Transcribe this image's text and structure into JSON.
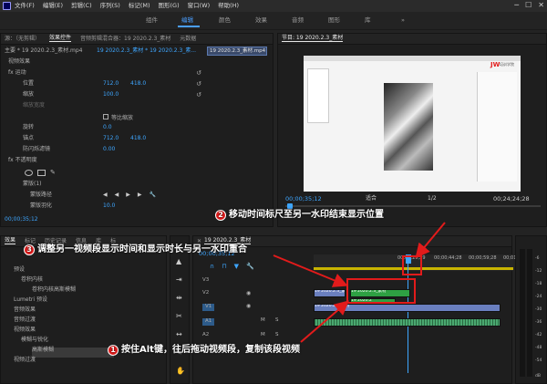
{
  "menu": {
    "items": [
      "文件(F)",
      "编辑(E)",
      "剪辑(C)",
      "序列(S)",
      "标记(M)",
      "图形(G)",
      "窗口(W)",
      "帮助(H)"
    ],
    "min": "─",
    "max": "☐",
    "close": "✕"
  },
  "workspaces": {
    "items": [
      "组件",
      "编辑",
      "颜色",
      "效果",
      "音频",
      "图形",
      "库"
    ],
    "more": "»"
  },
  "source_tabs": [
    "源：（无剪辑）",
    "效果控件",
    "音频剪辑混合器：19 2020.2.3_素材",
    "元数据"
  ],
  "effect_controls": {
    "master": "主要 * 19 2020.2.3_素材.mp4",
    "seq": "19 2020.2.3_素材 * 19 2020.2.3_素...",
    "clip_label": "19 2020.2.3_素材.mp4",
    "video_effects": "视频效果",
    "motion": "运动",
    "position": "位置",
    "pos_x": "712.0",
    "pos_y": "418.0",
    "scale": "缩放",
    "scale_v": "100.0",
    "scale_w": "缩放宽度",
    "uniform": "等比缩放",
    "rotation": "旋转",
    "rot_v": "0.0",
    "anchor": "锚点",
    "anc_x": "712.0",
    "anc_y": "418.0",
    "flicker": "防闪烁滤镜",
    "flick_v": "0.00",
    "opacity": "不透明度",
    "mask": "蒙版(1)",
    "mask_path": "蒙版路径",
    "mask_feather": "蒙版羽化",
    "feather_v": "10.0",
    "timecode": "00;00;35;12"
  },
  "program": {
    "title": "节目: 19 2020.2.3_素材",
    "timecode": "00;00;35;12",
    "fit": "适合",
    "res": "1/2",
    "duration": "00;24;24;28",
    "logo": "JW",
    "logo_sub": "培训学院"
  },
  "project": {
    "tabs": [
      "效果",
      "标记",
      "历史记录",
      "信息",
      "库",
      "标"
    ],
    "items": [
      "预设",
      "卷积内核",
      "卷积内核高斯模糊",
      "Lumetri 预设",
      "音频效果",
      "音频过渡",
      "视频效果",
      "视频过渡",
      "模糊与锐化",
      "高斯模糊",
      "视频过渡"
    ]
  },
  "timeline": {
    "tab": "19 2020.2.3_素材",
    "timecode": "00;00;35;12",
    "ruler": [
      "00;00;29;29",
      "00;00;44;28",
      "00;00;59;28",
      "00;01"
    ],
    "tracks": [
      "V3",
      "V2",
      "V1",
      "A1",
      "A2",
      "A3"
    ],
    "clip_v2": "19 2020.2.3_素材",
    "clip_v2b": "19 2020.2.3_素材",
    "clip_v1": "19 2020.2.3_素材",
    "clip_v1b": "19 2020.2",
    "mute": "M",
    "solo": "S"
  },
  "meter": {
    "labels": [
      "-6",
      "-12",
      "-18",
      "-24",
      "-30",
      "-36",
      "-42",
      "-48",
      "-54"
    ],
    "unit": "dB"
  },
  "annotations": {
    "n1": "1",
    "t1": "按住Alt键，往后拖动视频段，复制该段视频",
    "n2": "2",
    "t2": "移动时间标尺至另一水印结束显示位置",
    "n3": "3",
    "t3": "调整另一视频段显示时间和显示时长与另一水印重合"
  },
  "colors": {
    "accent": "#3ea6ff",
    "annotation_red": "#e21b1b",
    "clip_green": "#2ea043",
    "clip_blue": "#6a7fbf"
  }
}
